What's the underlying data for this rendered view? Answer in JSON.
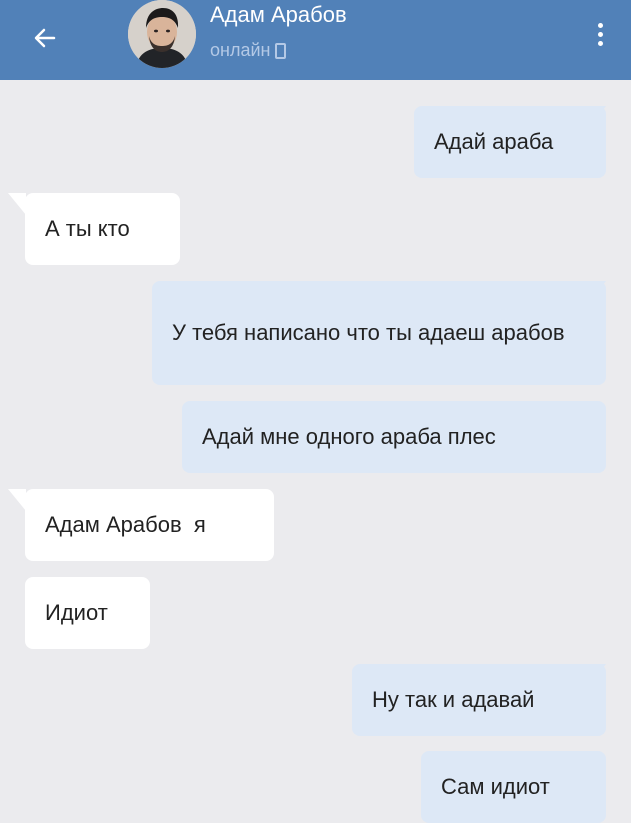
{
  "header": {
    "contact_name": "Адам Арабов",
    "status": "онлайн",
    "back_icon": "arrow-left-icon",
    "menu_icon": "more-vertical-icon",
    "background": "#5181b8"
  },
  "messages": [
    {
      "direction": "outgoing",
      "text": "Адай араба"
    },
    {
      "direction": "incoming",
      "text": "А ты кто"
    },
    {
      "direction": "outgoing",
      "text": "У тебя написано что ты адаеш арабов"
    },
    {
      "direction": "outgoing",
      "text": "Адай мне одного араба плес"
    },
    {
      "direction": "incoming",
      "text": "Адам Арабов  я"
    },
    {
      "direction": "incoming",
      "text": "Идиот"
    },
    {
      "direction": "outgoing",
      "text": "Ну так и адавай"
    },
    {
      "direction": "outgoing",
      "text": "Сам идиот"
    }
  ],
  "colors": {
    "chat_background": "#ebebee",
    "incoming_bubble": "#ffffff",
    "outgoing_bubble": "#dde8f6"
  }
}
